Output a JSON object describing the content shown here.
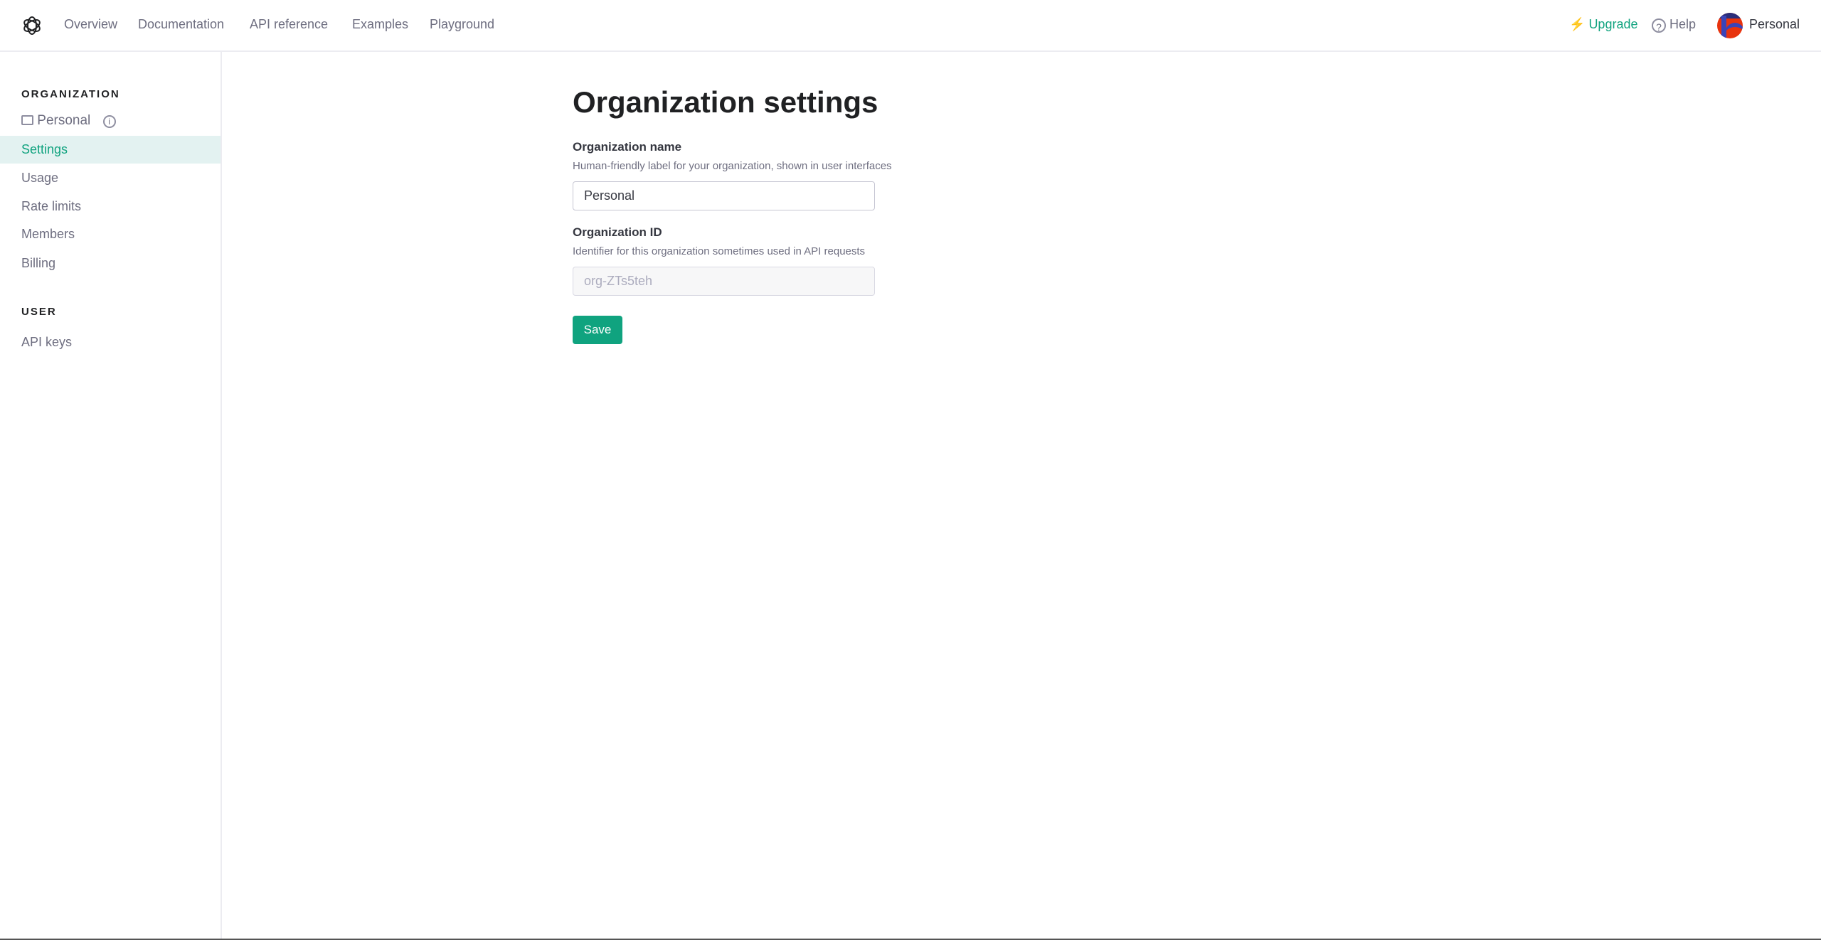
{
  "nav": {
    "items": [
      "Overview",
      "Documentation",
      "API reference",
      "Examples",
      "Playground"
    ]
  },
  "header_right": {
    "upgrade": "Upgrade",
    "help": "Help",
    "account": "Personal"
  },
  "sidebar": {
    "org_heading": "ORGANIZATION",
    "org_name": "Personal",
    "org_items": [
      "Settings",
      "Usage",
      "Rate limits",
      "Members",
      "Billing"
    ],
    "user_heading": "USER",
    "user_items": [
      "API keys"
    ]
  },
  "main": {
    "title": "Organization settings",
    "org_name_label": "Organization name",
    "org_name_desc": "Human-friendly label for your organization, shown in user interfaces",
    "org_name_value": "Personal",
    "org_id_label": "Organization ID",
    "org_id_desc": "Identifier for this organization sometimes used in API requests",
    "org_id_value": "org-ZTs5teh",
    "save_label": "Save"
  },
  "colors": {
    "accent": "#10a37f",
    "active_bg": "#e3f2f1"
  }
}
